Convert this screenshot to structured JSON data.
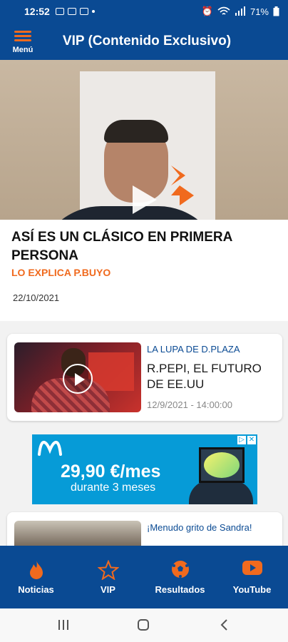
{
  "status_bar": {
    "time": "12:52",
    "battery": "71%"
  },
  "app_bar": {
    "menu_label": "Menú",
    "title": "VIP (Contenido Exclusivo)"
  },
  "featured": {
    "headline": " ASÍ ES UN CLÁSICO EN PRIMERA PERSONA",
    "subtitle": "LO EXPLICA P.BUYO",
    "date": "22/10/2021"
  },
  "cards": [
    {
      "category": "LA LUPA DE D.PLAZA",
      "title": "R.PEPI, EL FUTURO DE EE.UU",
      "time": "12/9/2021 - 14:00:00"
    },
    {
      "title": "¡Menudo grito de Sandra!"
    }
  ],
  "ad": {
    "price": "29,90 €/mes",
    "duration": "durante 3 meses"
  },
  "bottom_nav": [
    {
      "label": "Noticias",
      "icon": "flame-icon"
    },
    {
      "label": "VIP",
      "icon": "star-icon"
    },
    {
      "label": "Resultados",
      "icon": "soccer-ball-icon"
    },
    {
      "label": "YouTube",
      "icon": "youtube-icon"
    }
  ],
  "colors": {
    "brand_blue": "#0a4a93",
    "accent_orange": "#f06a1e",
    "ad_blue": "#069bd7"
  }
}
